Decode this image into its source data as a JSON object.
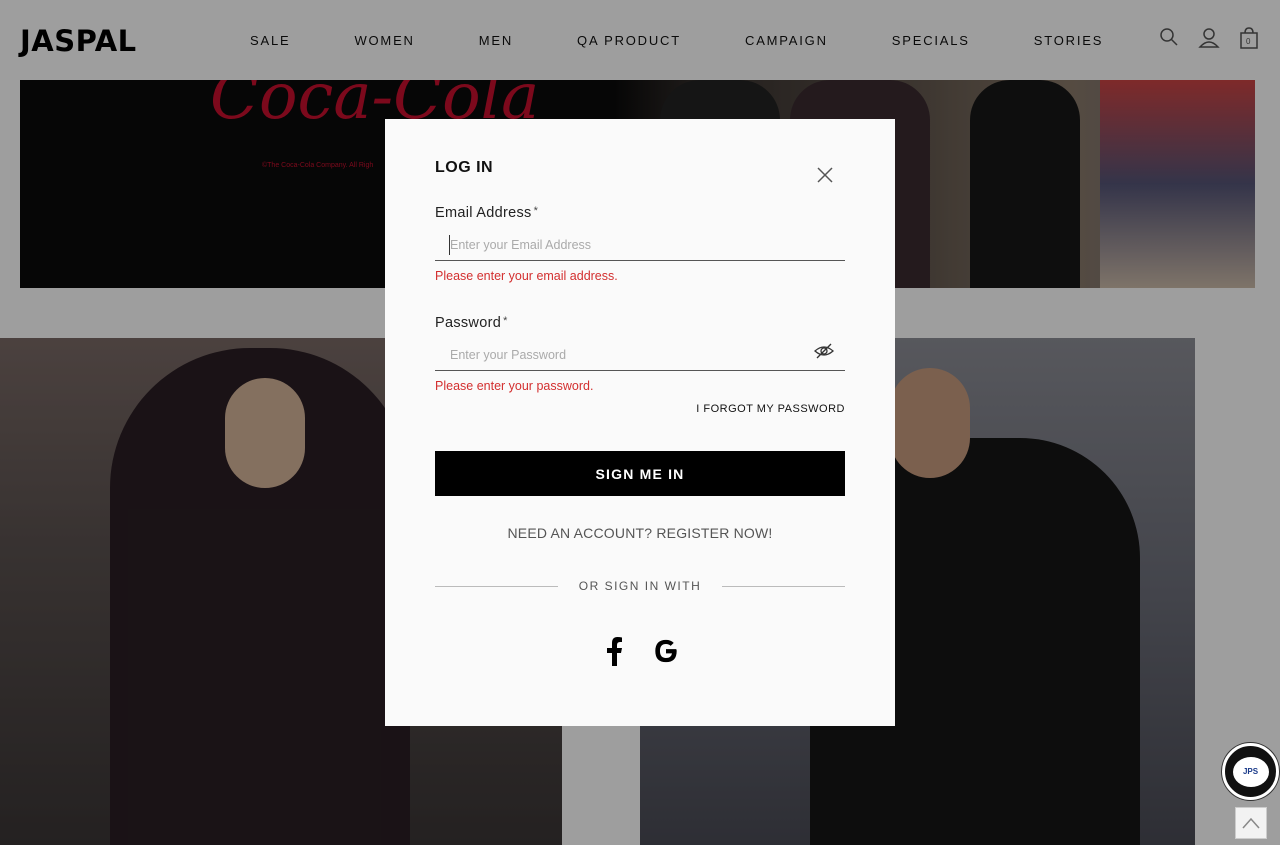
{
  "header": {
    "logo": "JASPAL",
    "nav": [
      "SALE",
      "WOMEN",
      "MEN",
      "QA PRODUCT",
      "CAMPAIGN",
      "SPECIALS",
      "STORIES"
    ],
    "icons": [
      "search-icon",
      "account-icon",
      "cart-icon"
    ],
    "cart_count": "0"
  },
  "hero": {
    "brand_text": "Coca-Cola",
    "fine_print": "©The Coca-Cola Company. All Righ"
  },
  "modal": {
    "title": "LOG IN",
    "email": {
      "label": "Email Address",
      "required_mark": "*",
      "placeholder": "Enter your Email Address",
      "value": "",
      "error": "Please enter your email address."
    },
    "password": {
      "label": "Password",
      "required_mark": "*",
      "placeholder": "Enter your Password",
      "value": "",
      "error": "Please enter your password."
    },
    "forgot_label": "I FORGOT MY PASSWORD",
    "signin_label": "SIGN ME IN",
    "register_label": "NEED AN ACCOUNT? REGISTER NOW!",
    "divider_label": "OR SIGN IN WITH",
    "social": [
      "facebook-icon",
      "google-icon"
    ]
  },
  "chat_widget": {
    "label": "JPS"
  },
  "colors": {
    "error": "#d32f2f",
    "button": "#000000",
    "overlay": "rgba(0,0,0,0.38)"
  }
}
